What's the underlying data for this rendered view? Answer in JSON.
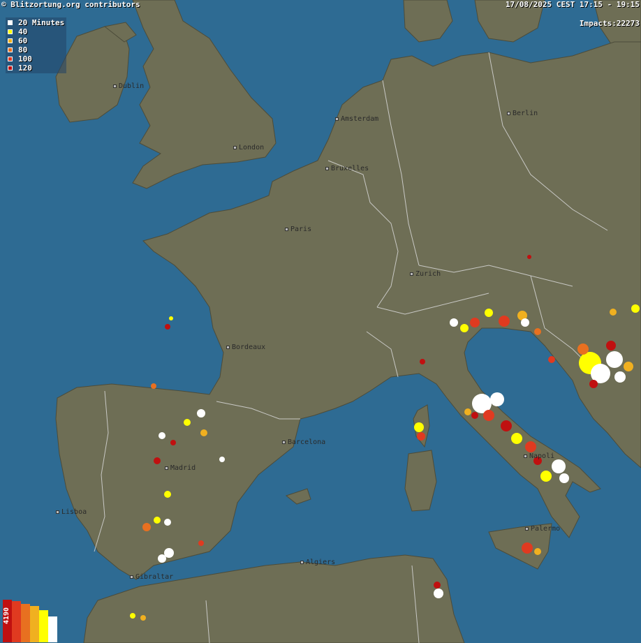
{
  "header": {
    "credit": "© Blitzortung.org contributors",
    "time_range": "17/08/2025 CEST 17:15 - 19:15",
    "impacts": "Impacts:22273"
  },
  "legend": {
    "items": [
      {
        "label": "20 Minutes",
        "color": "#ffffff"
      },
      {
        "label": "40",
        "color": "#ffff00"
      },
      {
        "label": "60",
        "color": "#f0b020"
      },
      {
        "label": "80",
        "color": "#e87020"
      },
      {
        "label": "100",
        "color": "#e03a20"
      },
      {
        "label": "120",
        "color": "#c01010"
      }
    ]
  },
  "histogram": {
    "max_label": "4190",
    "bars": [
      {
        "color": "#c01010",
        "value": 1.0
      },
      {
        "color": "#e03a20",
        "value": 0.97
      },
      {
        "color": "#e87020",
        "value": 0.9
      },
      {
        "color": "#f0b020",
        "value": 0.85
      },
      {
        "color": "#ffff00",
        "value": 0.75
      },
      {
        "color": "#ffffff",
        "value": 0.6
      }
    ]
  },
  "cities": [
    {
      "name": "Dublin"
    },
    {
      "name": "London"
    },
    {
      "name": "Amsterdam"
    },
    {
      "name": "Bruxelles"
    },
    {
      "name": "Berlin"
    },
    {
      "name": "Paris"
    },
    {
      "name": "Zurich"
    },
    {
      "name": "Bordeaux"
    },
    {
      "name": "Barcelona"
    },
    {
      "name": "Madrid"
    },
    {
      "name": "Lisboa"
    },
    {
      "name": "Gibraltar"
    },
    {
      "name": "Algiers"
    },
    {
      "name": "Napoli"
    },
    {
      "name": "Palermo"
    }
  ],
  "colors": {
    "sea": "#2e6b93",
    "land": "#6e6e55",
    "border": "#d8d8d8"
  }
}
